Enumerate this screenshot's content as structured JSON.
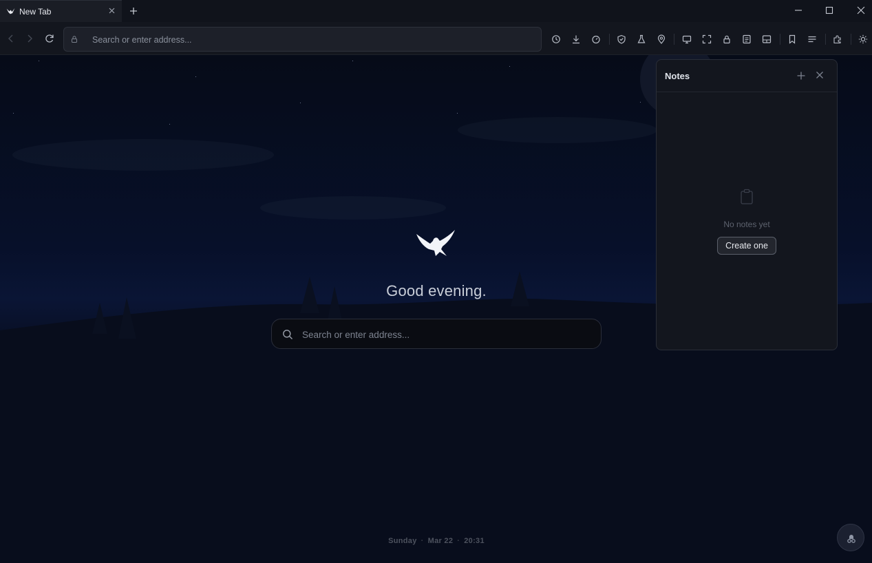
{
  "browser": {
    "tab": {
      "title": "New Tab",
      "favicon": "eagle-icon"
    },
    "window_controls": [
      "minimize-icon",
      "maximize-icon",
      "close-icon"
    ],
    "address_bar": {
      "placeholder": "Search or enter address..."
    },
    "toolbar_icons": [
      "history-icon",
      "download-icon",
      "timer-icon",
      "shield-icon",
      "flask-icon",
      "location-pin-icon",
      "monitor-icon",
      "fullscreen-icon",
      "lock-icon",
      "reader-icon",
      "sidebar-icon",
      "bookmark-icon",
      "menu-icon",
      "extensions-icon",
      "theme-sun-icon"
    ]
  },
  "newtab": {
    "greeting": "Good evening.",
    "search_placeholder": "Search or enter address...",
    "date": {
      "day": "Sunday",
      "date": "Mar 22",
      "time": "20:31"
    }
  },
  "notes_panel": {
    "title": "Notes",
    "empty_text": "No notes yet",
    "create_label": "Create one"
  },
  "colors": {
    "background": "#070a14",
    "panel": "#13161e",
    "accent_text": "#c9ced8"
  }
}
